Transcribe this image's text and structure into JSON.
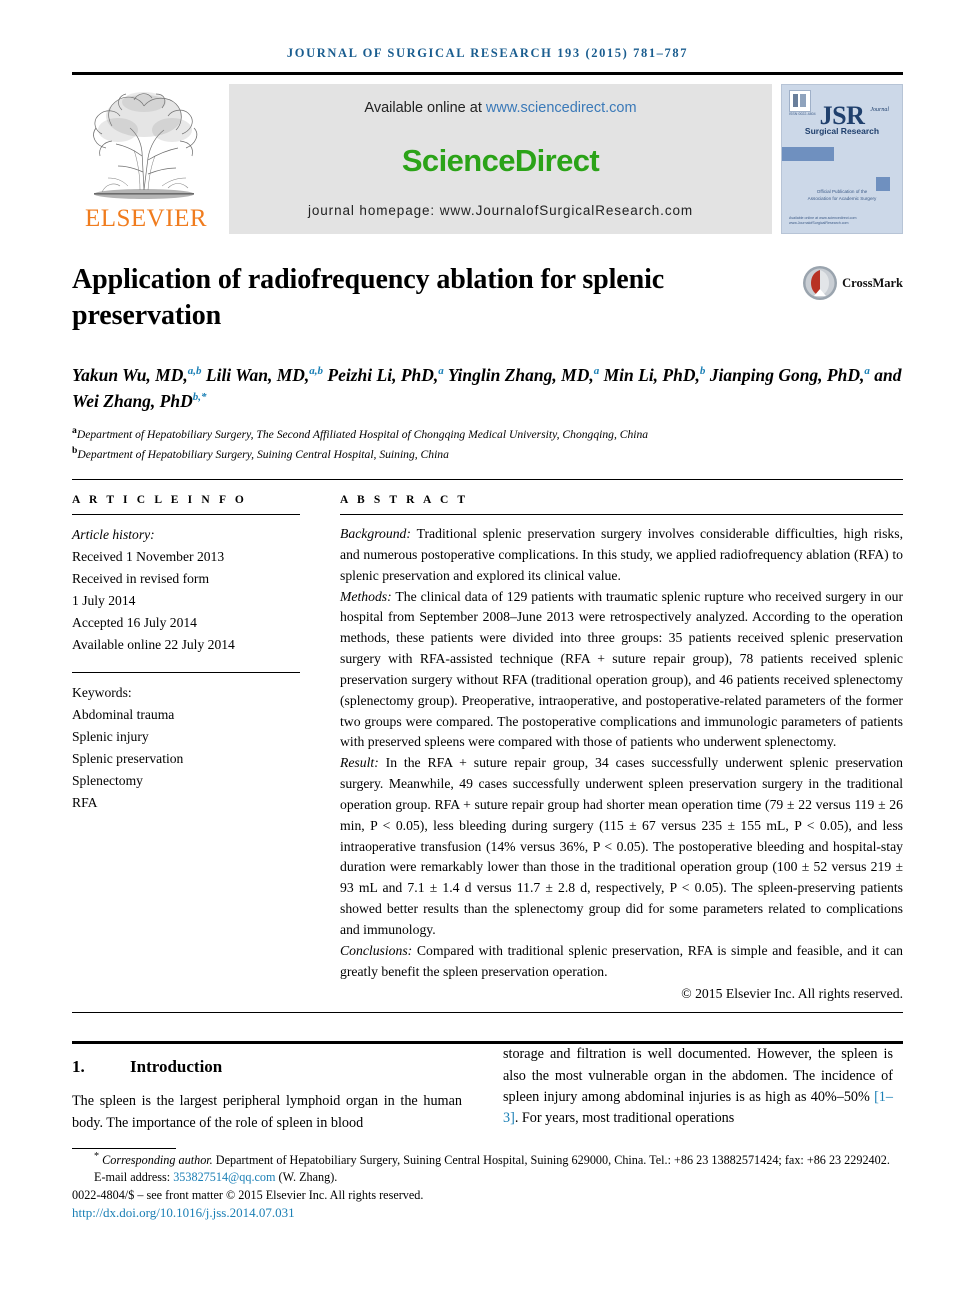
{
  "running_head": "JOURNAL OF SURGICAL RESEARCH 193 (2015) 781–787",
  "masthead": {
    "publisher_logo_text": "ELSEVIER",
    "available_prefix": "Available online at ",
    "available_url": "www.sciencedirect.com",
    "sciencedirect_logo": "ScienceDirect",
    "journal_homepage": "journal homepage: www.JournalofSurgicalResearch.com",
    "cover": {
      "title": "JSR",
      "journal_word": "Journal",
      "subtitle": "Surgical Research",
      "official_line1": "Official Publication of the",
      "official_line2": "Association for Academic Surgery",
      "issn": "ISSN 0022-4804",
      "foot_line1": "Available online at www.sciencedirect.com",
      "foot_line2": "www.JournalofSurgicalResearch.com"
    }
  },
  "article": {
    "title": "Application of radiofrequency ablation for splenic preservation",
    "crossmark_label": "CrossMark",
    "authors_html": "Yakun Wu, MD,<sup>a,b</sup> Lili Wan, MD,<sup>a,b</sup> Peizhi Li, PhD,<sup>a</sup> Yinglin Zhang, MD,<sup>a</sup> Min Li, PhD,<sup>b</sup> Jianping Gong, PhD,<sup>a</sup> and Wei Zhang, PhD<sup>b,*</sup>",
    "affiliations": [
      {
        "marker": "a",
        "text": "Department of Hepatobiliary Surgery, The Second Affiliated Hospital of Chongqing Medical University, Chongqing, China"
      },
      {
        "marker": "b",
        "text": "Department of Hepatobiliary Surgery, Suining Central Hospital, Suining, China"
      }
    ]
  },
  "article_info": {
    "heading": "A R T I C L E   I N F O",
    "history_label": "Article history:",
    "history": [
      "Received 1 November 2013",
      "Received in revised form",
      "1 July 2014",
      "Accepted 16 July 2014",
      "Available online 22 July 2014"
    ],
    "keywords_label": "Keywords:",
    "keywords": [
      "Abdominal trauma",
      "Splenic injury",
      "Splenic preservation",
      "Splenectomy",
      "RFA"
    ]
  },
  "abstract": {
    "heading": "A B S T R A C T",
    "sections": [
      {
        "label": "Background:",
        "text": " Traditional splenic preservation surgery involves considerable difficulties, high risks, and numerous postoperative complications. In this study, we applied radiofrequency ablation (RFA) to splenic preservation and explored its clinical value."
      },
      {
        "label": "Methods:",
        "text": " The clinical data of 129 patients with traumatic splenic rupture who received surgery in our hospital from September 2008–June 2013 were retrospectively analyzed. According to the operation methods, these patients were divided into three groups: 35 patients received splenic preservation surgery with RFA-assisted technique (RFA + suture repair group), 78 patients received splenic preservation surgery without RFA (traditional operation group), and 46 patients received splenectomy (splenectomy group). Preoperative, intraoperative, and postoperative-related parameters of the former two groups were compared. The postoperative complications and immunologic parameters of patients with preserved spleens were compared with those of patients who underwent splenectomy."
      },
      {
        "label": "Result:",
        "text": " In the RFA + suture repair group, 34 cases successfully underwent splenic preservation surgery. Meanwhile, 49 cases successfully underwent spleen preservation surgery in the traditional operation group. RFA + suture repair group had shorter mean operation time (79 ± 22 versus 119 ± 26 min, P < 0.05), less bleeding during surgery (115 ± 67 versus 235 ± 155 mL, P < 0.05), and less intraoperative transfusion (14% versus 36%, P < 0.05). The postoperative bleeding and hospital-stay duration were remarkably lower than those in the traditional operation group (100 ± 52 versus 219 ± 93 mL and 7.1 ± 1.4 d versus 11.7 ± 2.8 d, respectively, P < 0.05). The spleen-preserving patients showed better results than the splenectomy group did for some parameters related to complications and immunology."
      },
      {
        "label": "Conclusions:",
        "text": " Compared with traditional splenic preservation, RFA is simple and feasible, and it can greatly benefit the spleen preservation operation."
      }
    ],
    "copyright": "© 2015 Elsevier Inc. All rights reserved."
  },
  "introduction": {
    "number": "1.",
    "title": "Introduction",
    "left_text": "The spleen is the largest peripheral lymphoid organ in the human body. The importance of the role of spleen in blood",
    "right_text_before_ref": "storage and filtration is well documented. However, the spleen is also the most vulnerable organ in the abdomen. The incidence of spleen injury among abdominal injuries is as high as 40%–50% ",
    "right_reference": "[1–3]",
    "right_text_after_ref": ". For years, most traditional operations"
  },
  "footnote": {
    "corresponding_marker": "*",
    "corresponding_label": "Corresponding author.",
    "corresponding_text": " Department of Hepatobiliary Surgery, Suining Central Hospital, Suining 629000, China. Tel.: +86 23 13882571424; fax: +86 23 2292402.",
    "email_label": "E-mail address: ",
    "email": "353827514@qq.com",
    "email_suffix": " (W. Zhang).",
    "issn_line": "0022-4804/$ – see front matter © 2015 Elsevier Inc. All rights reserved.",
    "doi": "http://dx.doi.org/10.1016/j.jss.2014.07.031"
  },
  "colors": {
    "link_blue": "#1a7fb5",
    "running_head_blue": "#1a5d8f",
    "sciencedirect_green": "#2ba318",
    "elsevier_orange": "#f07c1e",
    "banner_gray": "#e3e3e3",
    "cover_blue": "#ccd8e8"
  }
}
